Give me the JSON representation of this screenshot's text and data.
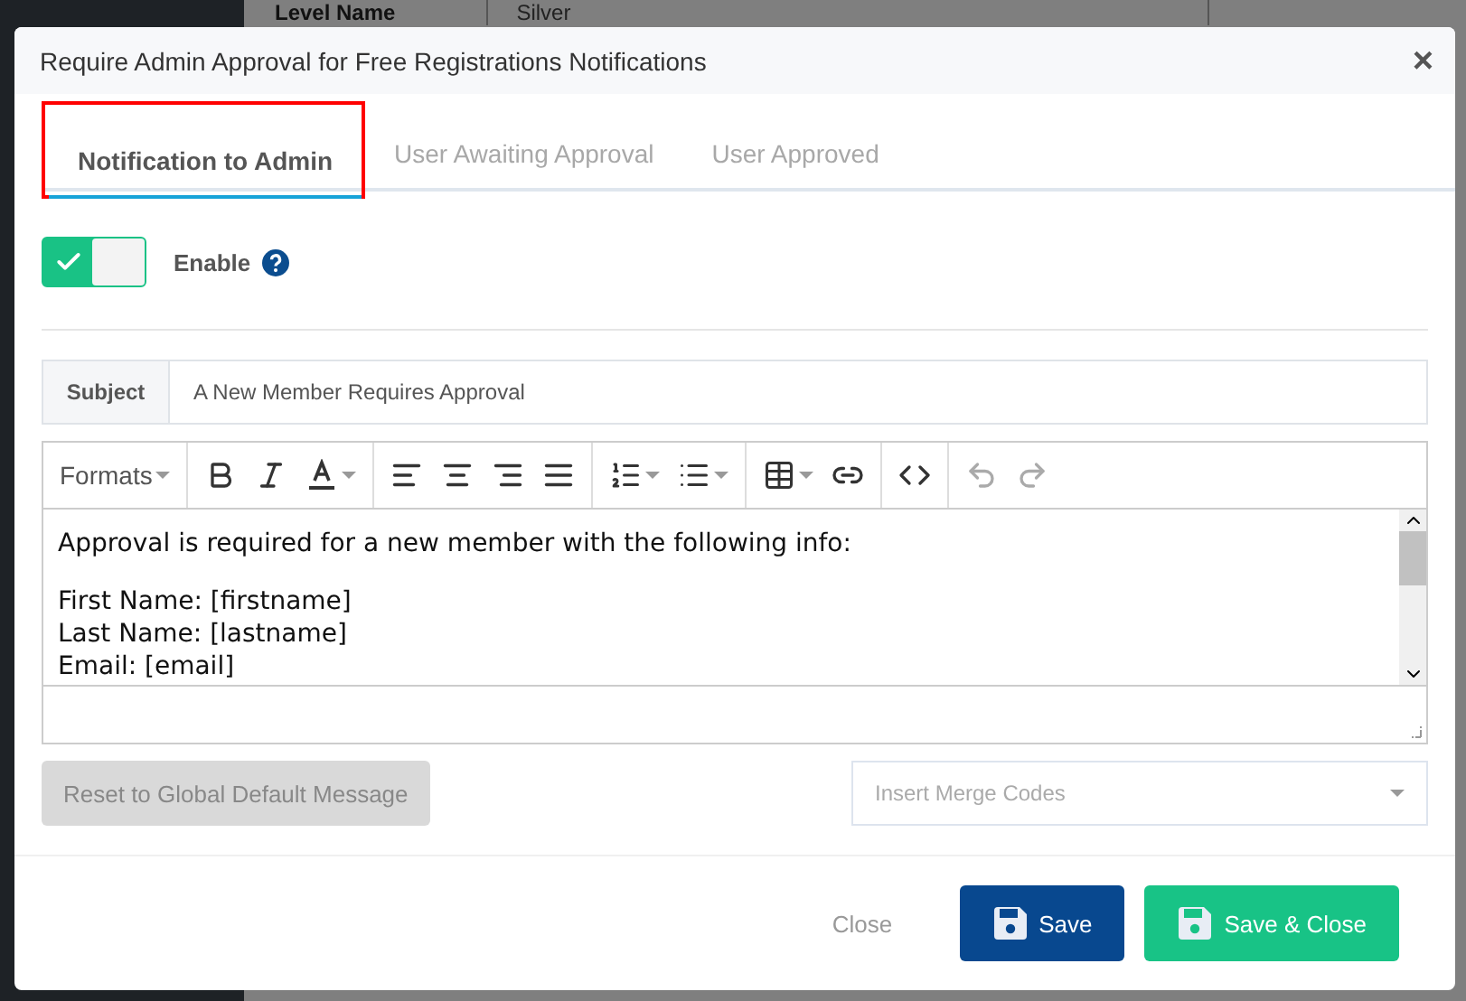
{
  "background": {
    "field_label": "Level Name",
    "field_value": "Silver"
  },
  "dialog": {
    "title": "Require Admin Approval for Free Registrations Notifications",
    "close": "×"
  },
  "tabs": [
    {
      "label": "Notification to Admin",
      "selected": true
    },
    {
      "label": "User Awaiting Approval",
      "selected": false
    },
    {
      "label": "User Approved",
      "selected": false
    }
  ],
  "enable": {
    "label": "Enable",
    "on": true
  },
  "subject": {
    "label": "Subject",
    "value": "A New Member Requires Approval"
  },
  "editor": {
    "formats": "Formats",
    "paragraphs": [
      [
        "Approval is required for a new member with the following info:"
      ],
      [
        "First Name: [firstname]",
        "Last Name: [lastname]",
        "Email: [email]"
      ]
    ]
  },
  "reset_button": {
    "label": "Reset to Global Default Message",
    "disabled": true
  },
  "merge_codes": {
    "placeholder": "Insert Merge Codes"
  },
  "footer": {
    "close": "Close",
    "save": "Save",
    "save_close": "Save & Close"
  }
}
